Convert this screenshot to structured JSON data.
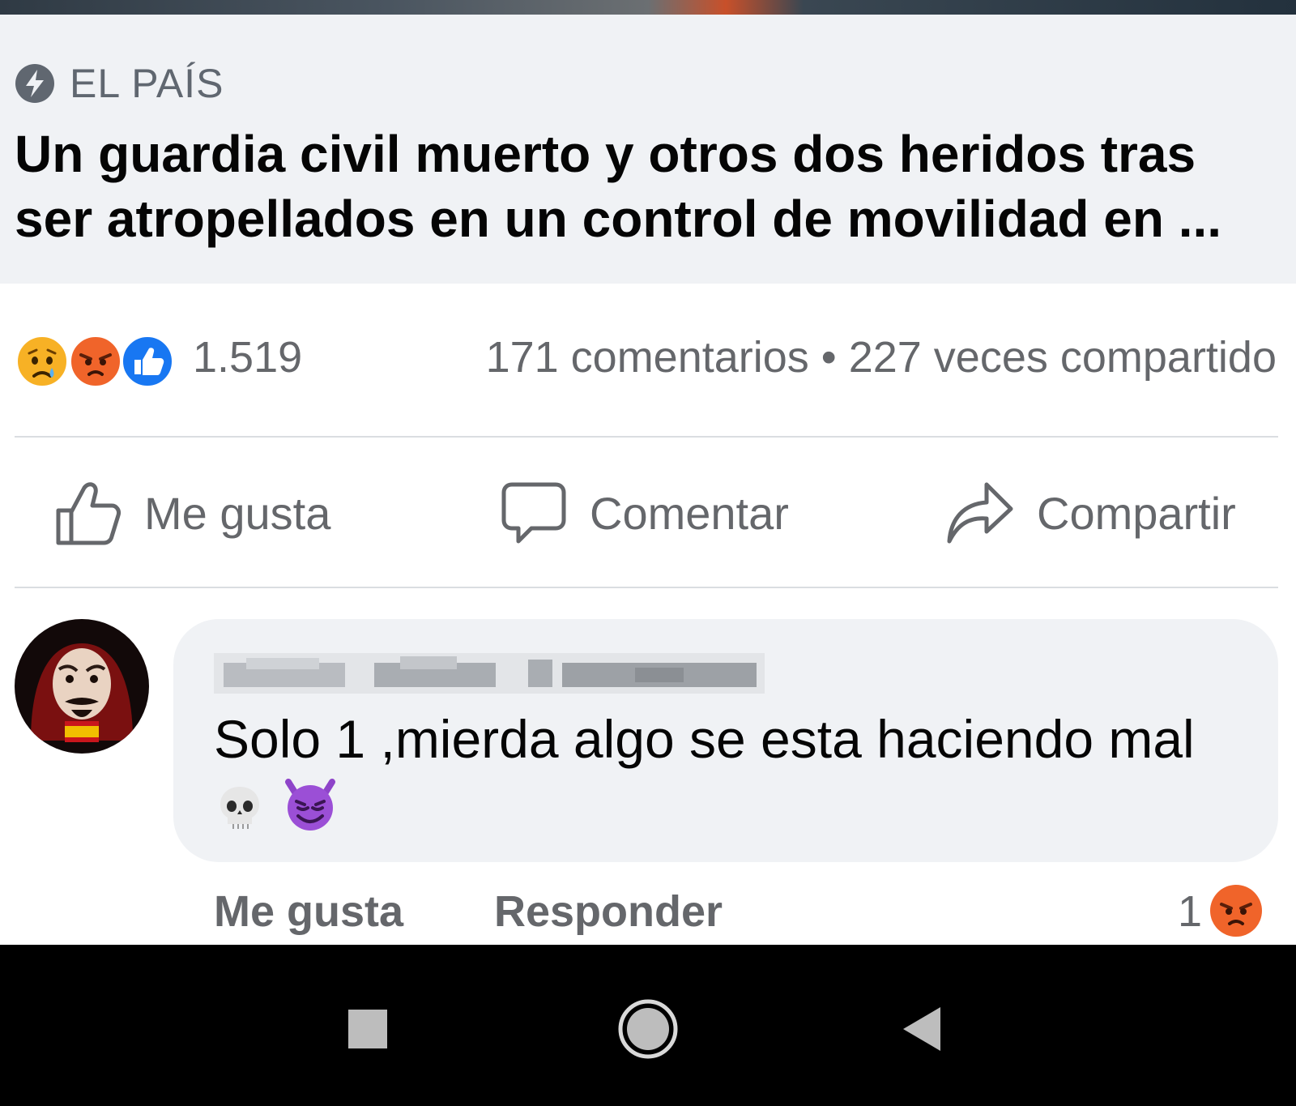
{
  "link_preview": {
    "source_icon": "lightning-icon",
    "source": "EL PAÍS",
    "headline": "Un guardia civil muerto y otros dos heridos tras ser atropellados en un control de movilidad en ..."
  },
  "reactions": {
    "icons": [
      "sad-icon",
      "angry-icon",
      "like-icon"
    ],
    "count": "1.519",
    "engagement": "171 comentarios • 227 veces compartido"
  },
  "actions": {
    "like": {
      "icon": "thumbs-up-icon",
      "label": "Me gusta"
    },
    "comment": {
      "icon": "comment-bubble-icon",
      "label": "Comentar"
    },
    "share": {
      "icon": "share-arrow-icon",
      "label": "Compartir"
    }
  },
  "comment": {
    "avatar": "masked-face-avatar",
    "author": "",
    "text": "Solo 1 ,mierda algo se esta haciendo mal",
    "emojis": [
      "skull-icon",
      "smiling-devil-icon"
    ],
    "like_label": "Me gusta",
    "reply_label": "Responder",
    "reaction_count": "1",
    "reaction_icon": "angry-icon"
  },
  "navbar": {
    "buttons": [
      "recent-apps-icon",
      "home-icon",
      "back-icon"
    ]
  },
  "colors": {
    "preview_bg": "#f0f2f5",
    "secondary_text": "#65676b",
    "primary_text": "#050505",
    "like_blue": "#1877f2",
    "angry_orange": "#f0642a",
    "sad_yellow": "#f7b125"
  }
}
